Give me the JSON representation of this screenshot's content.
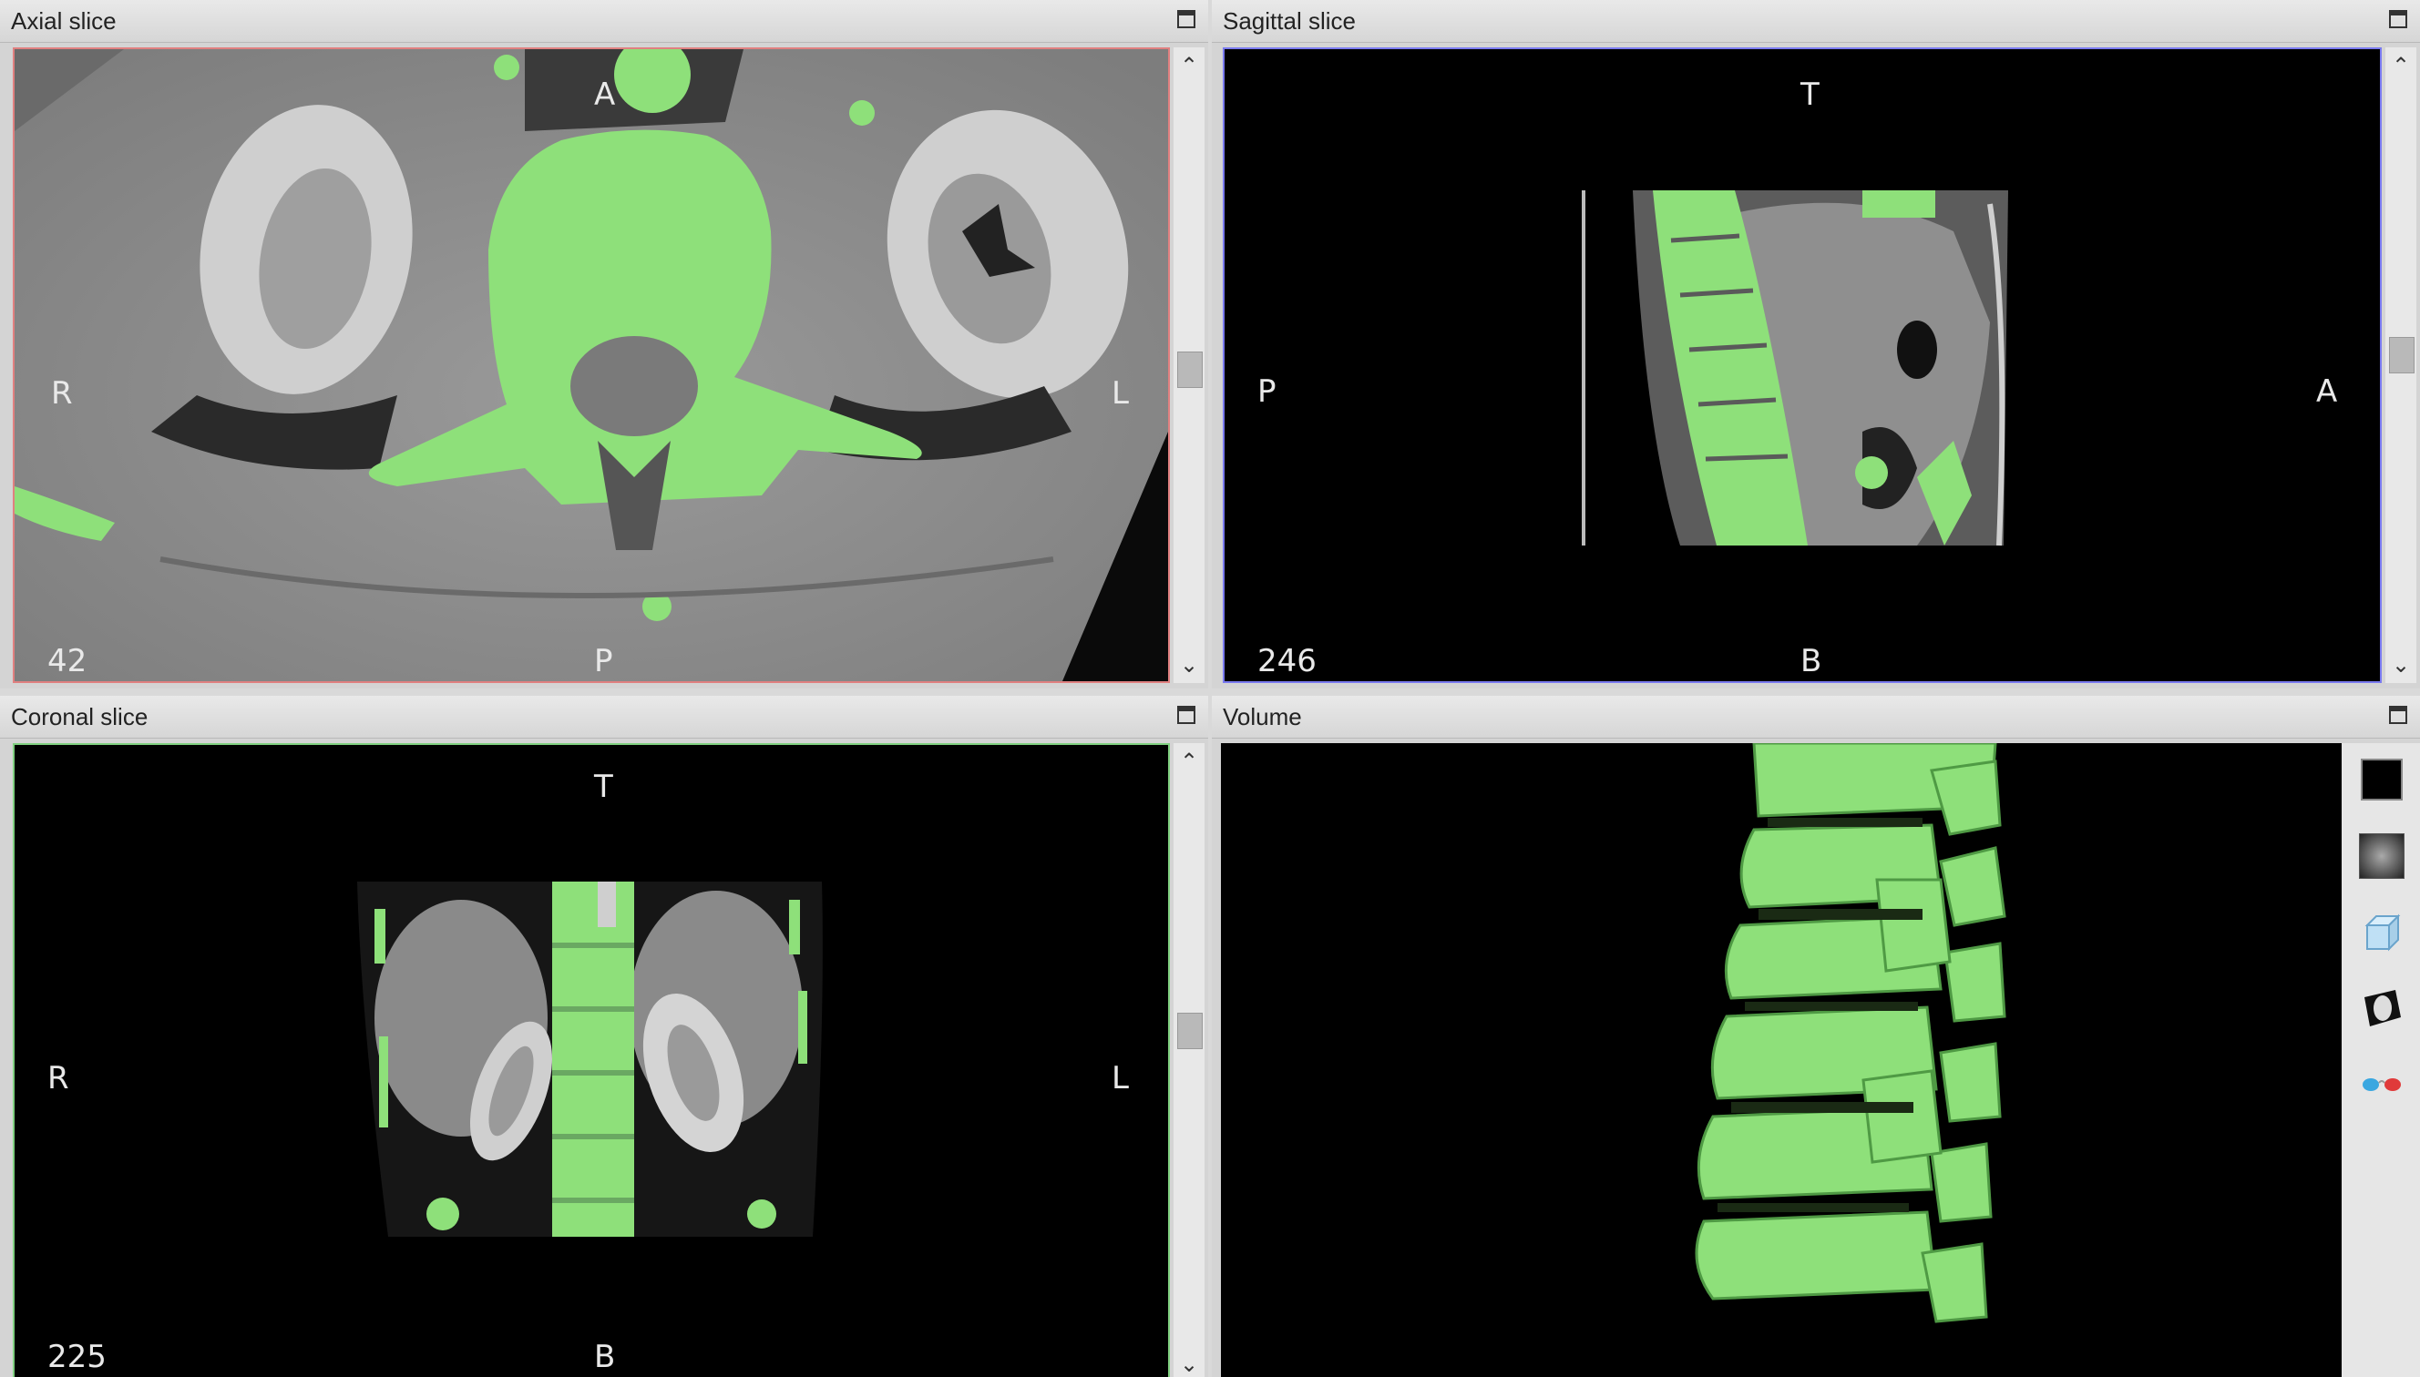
{
  "panels": {
    "axial": {
      "title": "Axial slice",
      "labels": {
        "top": "A",
        "bottom": "P",
        "left": "R",
        "right": "L"
      },
      "slice": "42"
    },
    "sagittal": {
      "title": "Sagittal slice",
      "labels": {
        "top": "T",
        "bottom": "B",
        "left": "P",
        "right": "A"
      },
      "slice": "246"
    },
    "coronal": {
      "title": "Coronal slice",
      "labels": {
        "top": "T",
        "bottom": "B",
        "left": "R",
        "right": "L"
      },
      "slice": "225"
    },
    "volume": {
      "title": "Volume"
    }
  },
  "scroll": {
    "up": "⌃",
    "down": "⌄"
  },
  "toolbar_icons": [
    "background-color-icon",
    "volume-render-icon",
    "bounding-box-icon",
    "orientation-icon",
    "stereo-glasses-icon"
  ],
  "colors": {
    "segmentation": "#8EE07A",
    "axial_border": "#e08080",
    "sagittal_border": "#7a7af0",
    "coronal_border": "#80d080"
  }
}
